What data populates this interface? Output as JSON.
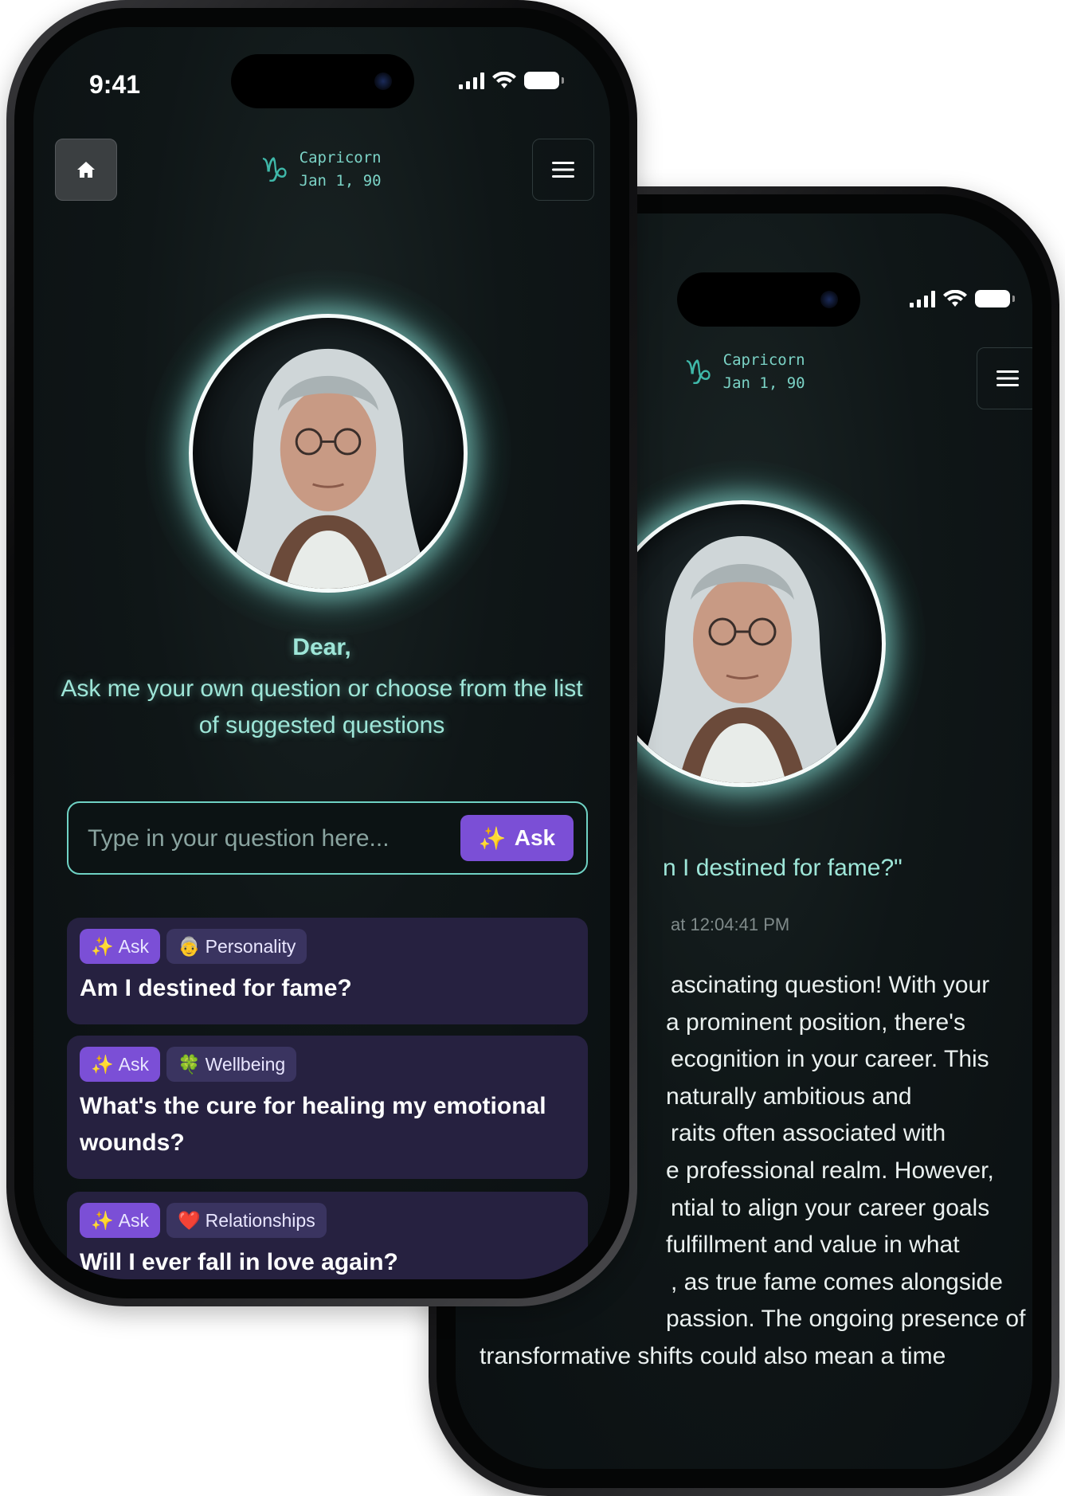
{
  "back_phone": {
    "status": {
      "time": ""
    },
    "header": {
      "sign_name": "Capricorn",
      "sign_date": "Jan 1, 90",
      "sign_icon": "capricorn-icon",
      "menu_icon": "hamburger-menu-icon"
    },
    "answer": {
      "question_fragment": "n I destined for fame?\"",
      "timestamp_fragment": "at 12:04:41 PM",
      "lines": [
        "ascinating question! With your",
        "a prominent position, there's",
        "ecognition in your career. This",
        "naturally ambitious and",
        "raits often associated with",
        "e professional realm. However,",
        "ntial to align your career goals",
        "fulfillment and value in what",
        ", as true fame comes alongside",
        "passion. The ongoing presence of",
        "transformative shifts could also mean a time"
      ]
    }
  },
  "front_phone": {
    "status": {
      "time": "9:41"
    },
    "header": {
      "home_icon": "home-icon",
      "sign_name": "Capricorn",
      "sign_date": "Jan 1, 90",
      "sign_icon": "capricorn-icon",
      "menu_icon": "hamburger-menu-icon"
    },
    "greeting": {
      "title": "Dear,",
      "body": "Ask me your own question or choose from the list of suggested questions"
    },
    "ask_input": {
      "placeholder": "Type in your question here...",
      "button_label": "Ask"
    },
    "questions": [
      {
        "ask_label": "Ask",
        "category_emoji": "👵",
        "category": "Personality",
        "text": "Am I destined for fame?"
      },
      {
        "ask_label": "Ask",
        "category_emoji": "🍀",
        "category": "Wellbeing",
        "text": "What's the cure for healing my emotional wounds?"
      },
      {
        "ask_label": "Ask",
        "category_emoji": "❤️",
        "category": "Relationships",
        "text": "Will I ever fall in love again?"
      }
    ]
  },
  "colors": {
    "accent_teal": "#9ee6d8",
    "accent_purple": "#7b4fd6",
    "card_bg": "#262140",
    "screen_bg": "#0f1617"
  }
}
